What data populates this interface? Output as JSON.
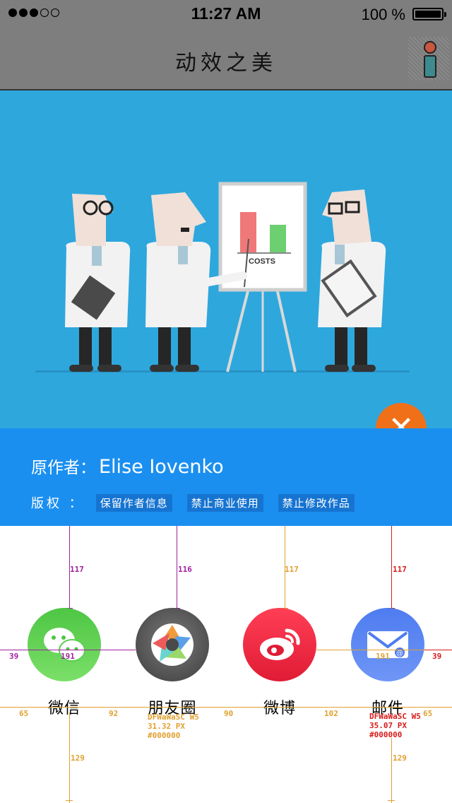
{
  "status_bar": {
    "signal_dots": 5,
    "signal_filled": 3,
    "time": "11:27 AM",
    "battery": "100 %"
  },
  "nav": {
    "title": "动效之美",
    "info_icon": "info-icon"
  },
  "chart_card": {
    "caption": "COSTS"
  },
  "info_panel": {
    "author_label": "原作者：",
    "author_name": "Elise Iovenko",
    "copyright_label": "版权 ：",
    "tags": [
      "保留作者信息",
      "禁止商业使用",
      "禁止修改作品"
    ]
  },
  "share": {
    "items": [
      {
        "label": "微信",
        "icon": "wechat-icon"
      },
      {
        "label": "朋友圈",
        "icon": "moments-icon"
      },
      {
        "label": "微博",
        "icon": "weibo-icon"
      },
      {
        "label": "邮件",
        "icon": "mail-icon"
      }
    ]
  },
  "annotations": {
    "top_gaps": [
      "117",
      "116",
      "117",
      "117"
    ],
    "circle_left": "39",
    "circle_width_1": "191",
    "circle_width_4": "191",
    "circle_right": "39",
    "label_gaps": [
      "65",
      "92",
      "90",
      "102",
      "65"
    ],
    "bottom_gaps": [
      "129",
      "129"
    ],
    "spec_moments": [
      "DFWaWaSC W5",
      "31.32 PX",
      "#000000"
    ],
    "spec_mail": [
      "DFWaWaSC W5",
      "35.07 PX",
      "#000000"
    ]
  },
  "colors": {
    "status_bg": "#7e7e7e",
    "hero_bg": "#2ea7dd",
    "panel_bg": "#1b8ff0",
    "close_button": "#f07019",
    "wechat": "#4ec644",
    "weibo": "#e01b35",
    "mail": "#4e7cf0",
    "annotation_purple": "#a020a0",
    "annotation_orange": "#e0a030",
    "annotation_red": "#d81b1b"
  }
}
